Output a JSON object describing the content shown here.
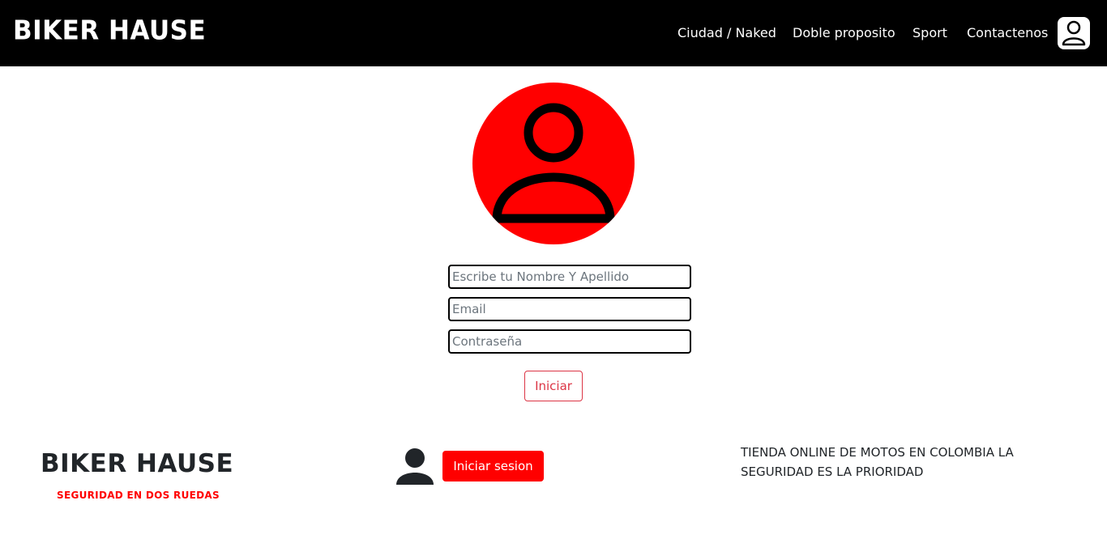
{
  "header": {
    "brand": "BIKER HAUSE",
    "nav": [
      {
        "label": "Ciudad / Naked"
      },
      {
        "label": "Doble proposito"
      },
      {
        "label": "Sport"
      },
      {
        "label": "Contactenos"
      }
    ],
    "user_icon": "user-icon"
  },
  "form": {
    "avatar_icon": "user-avatar-icon",
    "avatar_color": "#ff0000",
    "name_placeholder": "Escribe tu Nombre Y Apellido",
    "email_placeholder": "Email",
    "password_placeholder": "Contraseña",
    "submit_label": "Iniciar",
    "submit_color": "#dc3545"
  },
  "footer": {
    "brand": "BIKER HAUSE",
    "tagline": "SEGURIDAD EN DOS RUEDAS",
    "user_icon": "person-icon",
    "login_label": "Iniciar sesion",
    "login_color": "#ff0000",
    "description": "TIENDA ONLINE DE MOTOS EN COLOMBIA LA SEGURIDAD ES LA PRIORIDAD"
  }
}
